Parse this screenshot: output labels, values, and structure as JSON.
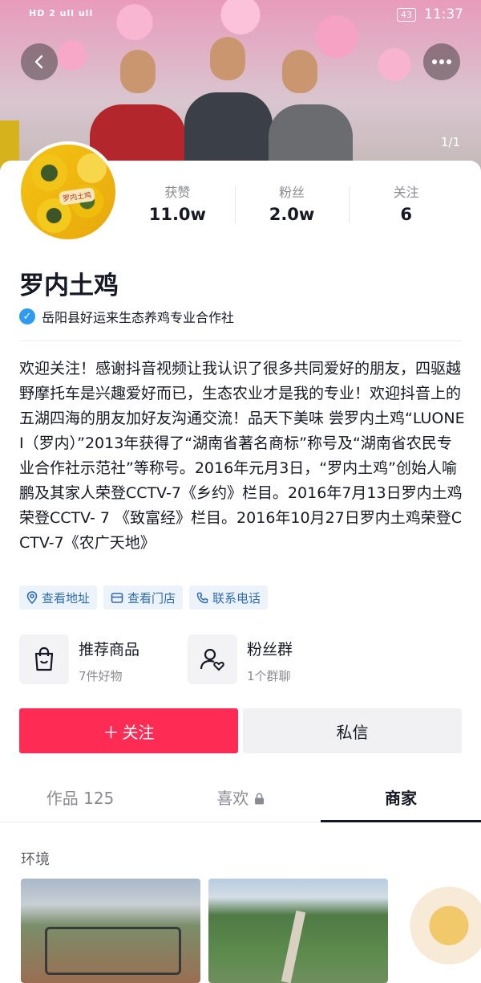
{
  "status_bar": {
    "left_text": "HD 2 ull ull",
    "battery": "43",
    "time": "11:37"
  },
  "header": {
    "back_icon": "chevron-left-icon",
    "more_icon": "more-dots-icon",
    "photo_counter": "1/1"
  },
  "avatar": {
    "label": "罗内土鸡"
  },
  "stats": [
    {
      "label": "获赞",
      "value": "11.0w"
    },
    {
      "label": "粉丝",
      "value": "2.0w"
    },
    {
      "label": "关注",
      "value": "6"
    }
  ],
  "profile": {
    "name": "罗内土鸡",
    "verified_text": "岳阳县好运来生态养鸡专业合作社",
    "bio": "欢迎关注！感谢抖音视频让我认识了很多共同爱好的朋友，四驱越野摩托车是兴趣爱好而已，生态农业才是我的专业！欢迎抖音上的五湖四海的朋友加好友沟通交流！品天下美味     尝罗内土鸡“LUONEI（罗内）”2013年获得了“湖南省著名商标”称号及“湖南省农民专业合作社示范社”等称号。2016年元月3日，“罗内土鸡”创始人喻鹏及其家人荣登CCTV-7《乡约》栏目。2016年7月13日罗内土鸡荣登CCTV- 7 《致富经》栏目。2016年10月27日罗内土鸡荣登CCTV-7《农广天地》"
  },
  "chips": [
    {
      "icon": "location-pin-icon",
      "label": "查看地址"
    },
    {
      "icon": "store-icon",
      "label": "查看门店"
    },
    {
      "icon": "phone-icon",
      "label": "联系电话"
    }
  ],
  "features": {
    "shop": {
      "icon": "shopping-bag-icon",
      "title": "推荐商品",
      "sub": "7件好物"
    },
    "fans": {
      "icon": "fan-group-icon",
      "title": "粉丝群",
      "sub": "1个群聊"
    }
  },
  "actions": {
    "follow": "关注",
    "message": "私信"
  },
  "tabs": [
    {
      "label": "作品 125",
      "active": false
    },
    {
      "label": "喜欢",
      "active": false,
      "locked": true
    },
    {
      "label": "商家",
      "active": true
    }
  ],
  "section": {
    "label": "环境"
  },
  "colors": {
    "primary": "#fe2c55",
    "verify": "#2f9bf0",
    "chip_text": "#2f6db3",
    "chip_bg": "#edf3fb"
  }
}
